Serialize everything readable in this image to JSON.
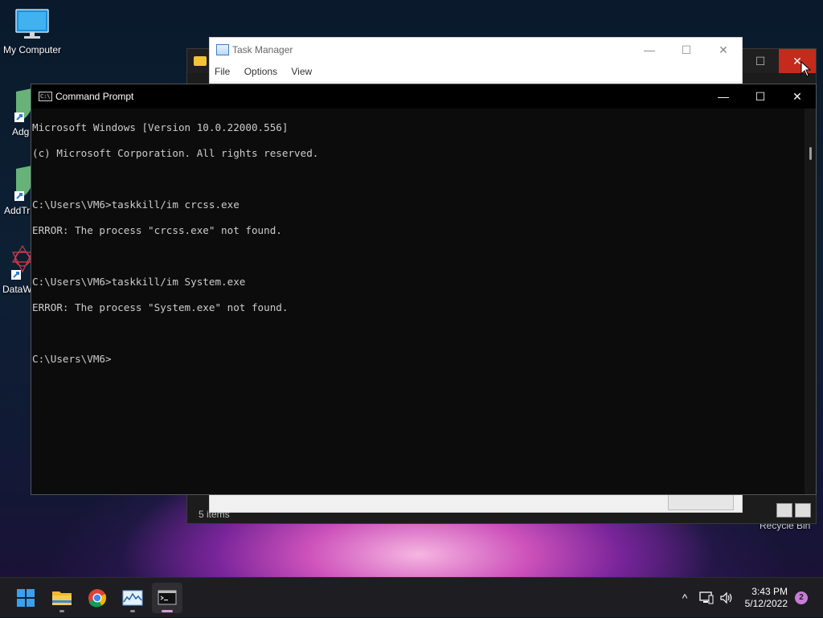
{
  "desktop": {
    "my_computer_label": "My Computer",
    "partial_labels": [
      "Adg",
      "AddTri",
      "DataW"
    ],
    "recycle_bin_label": "Recycle Bin"
  },
  "explorer": {
    "status_text": "5 items",
    "close_glyph": "✕",
    "max_glyph": "☐"
  },
  "task_manager": {
    "title": "Task Manager",
    "menu": [
      "File",
      "Options",
      "View"
    ],
    "min_glyph": "—",
    "max_glyph": "☐",
    "close_glyph": "✕"
  },
  "cmd": {
    "title": "Command Prompt",
    "icon_text": "C:\\",
    "min_glyph": "—",
    "max_glyph": "☐",
    "close_glyph": "✕",
    "lines": [
      "Microsoft Windows [Version 10.0.22000.556]",
      "(c) Microsoft Corporation. All rights reserved.",
      "",
      "C:\\Users\\VM6>taskkill/im crcss.exe",
      "ERROR: The process \"crcss.exe\" not found.",
      "",
      "C:\\Users\\VM6>taskkill/im System.exe",
      "ERROR: The process \"System.exe\" not found.",
      "",
      "C:\\Users\\VM6>"
    ]
  },
  "taskbar": {
    "time": "3:43 PM",
    "date": "5/12/2022",
    "notification_count": "2",
    "tray_chevron": "^"
  },
  "colors": {
    "accent_close": "#c42b1c",
    "console_text": "#cccccc",
    "console_bg": "#0c0c0c"
  }
}
